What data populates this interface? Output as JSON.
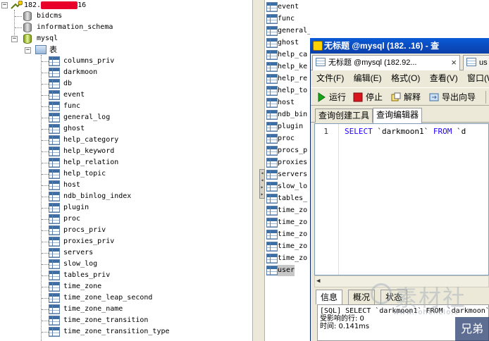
{
  "tree": {
    "connection_label_prefix": "182.",
    "connection_label_suffix": "16",
    "databases": [
      "bidcms",
      "information_schema",
      "mysql"
    ],
    "tables_folder": "表",
    "tables": [
      "columns_priv",
      "darkmoon",
      "db",
      "event",
      "func",
      "general_log",
      "ghost",
      "help_category",
      "help_keyword",
      "help_relation",
      "help_topic",
      "host",
      "ndb_binlog_index",
      "plugin",
      "proc",
      "procs_priv",
      "proxies_priv",
      "servers",
      "slow_log",
      "tables_priv",
      "time_zone",
      "time_zone_leap_second",
      "time_zone_name",
      "time_zone_transition",
      "time_zone_transition_type"
    ]
  },
  "middle_list": {
    "items": [
      "event",
      "func",
      "general_log",
      "ghost",
      "help_ca",
      "help_ke",
      "help_re",
      "help_to",
      "host",
      "ndb_bin",
      "plugin",
      "proc",
      "procs_p",
      "proxies",
      "servers",
      "slow_lo",
      "tables_",
      "time_zo",
      "time_zo",
      "time_zo",
      "time_zo",
      "time_zo",
      "user"
    ],
    "selected": "user"
  },
  "query_window": {
    "title": "无标题 @mysql (182.  .16) - 查",
    "doc_tab_label": "无标题 @mysql (182.92...",
    "doc_tab_close": "×",
    "doc_tab2_label": "us",
    "menu": [
      "文件(F)",
      "编辑(E)",
      "格式(O)",
      "查看(V)",
      "窗口(W)"
    ],
    "toolbar": {
      "run": "运行",
      "stop": "停止",
      "explain": "解释",
      "export_wizard": "导出向导"
    },
    "editor_tabs": [
      "查询创建工具",
      "查询编辑器"
    ],
    "line_number": "1",
    "code": {
      "kw1": "SELECT",
      "ident1": " `darkmoon1` ",
      "kw2": "FROM",
      "ident2": " `d"
    },
    "bottom_tabs": [
      "信息",
      "概况",
      "状态"
    ],
    "messages": [
      "[SQL] SELECT `darkmoon1` FROM `darkmoon`",
      "受影响的行: 0",
      "时间: 0.141ms"
    ]
  },
  "watermark": {
    "text": "素材社",
    "url": "www.fohenelo.c",
    "badge": "兄弟"
  },
  "colors": {
    "title_bar": "#0a5ad7",
    "keyword": "#1f00ff",
    "redaction": "#e8002a"
  }
}
